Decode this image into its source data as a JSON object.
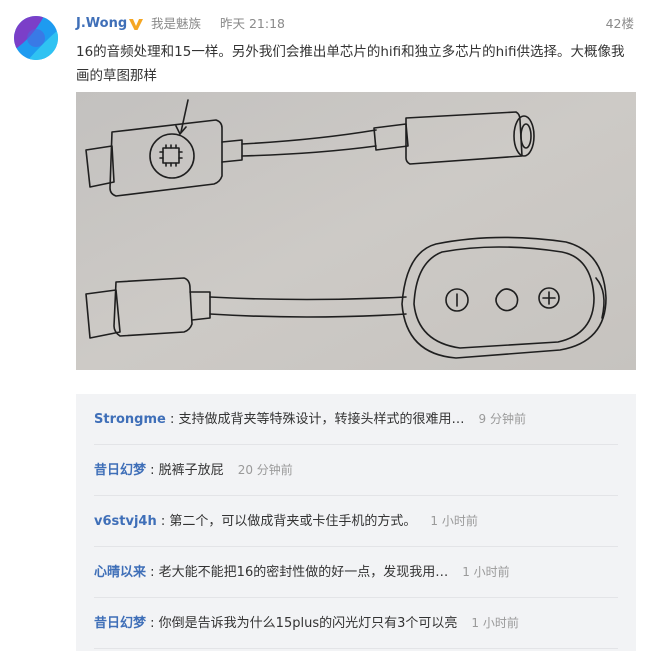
{
  "post": {
    "username": "J.Wong",
    "badge": "我是魅族",
    "time": "昨天 21:18",
    "floor": "42楼",
    "content": "16的音频处理和15一样。另外我们会推出单芯片的hifi和独立多芯片的hifi供选择。大概像我画的草图那样",
    "verified_color": "#f5a623"
  },
  "comments": [
    {
      "name": "Strongme",
      "sep": " : ",
      "text": "支持做成背夹等特殊设计，转接头样式的很难用…",
      "time": "9 分钟前"
    },
    {
      "name": "昔日幻梦",
      "sep": " : ",
      "text": "脱裤子放屁",
      "time": "20 分钟前"
    },
    {
      "name": "v6stvj4h",
      "sep": " : ",
      "text": "第二个，可以做成背夹或卡住手机的方式。",
      "time": "1 小时前"
    },
    {
      "name": "心晴以来",
      "sep": " : ",
      "text": "老大能不能把16的密封性做的好一点，发现我用…",
      "time": "1 小时前"
    },
    {
      "name": "昔日幻梦",
      "sep": " : ",
      "text": "你倒是告诉我为什么15plus的闪光灯只有3个可以亮",
      "time": "1 小时前"
    }
  ],
  "colors": {
    "link": "#3f6fb8",
    "muted": "#8a8a8a",
    "comment_bg": "#f2f3f5"
  }
}
